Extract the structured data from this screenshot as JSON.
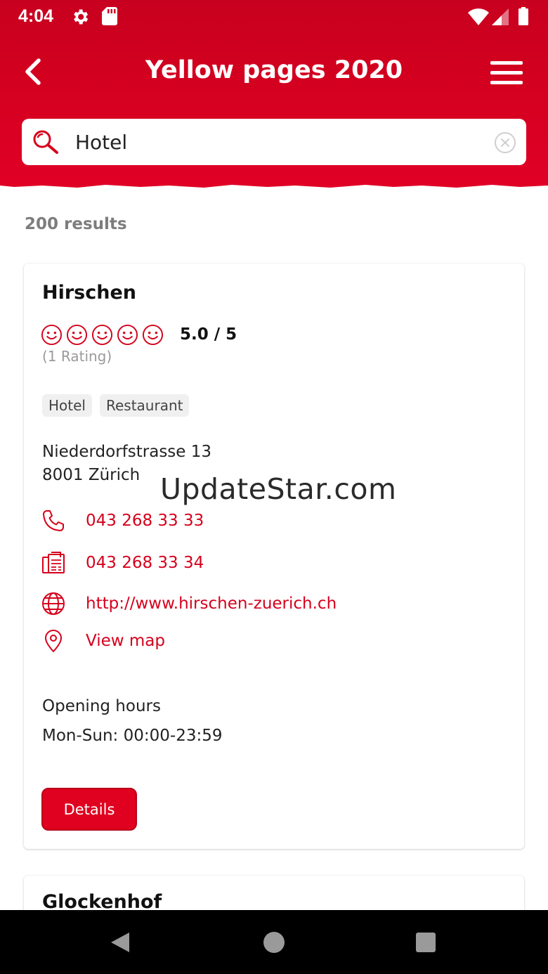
{
  "status_bar": {
    "time": "4:04"
  },
  "header": {
    "title": "Yellow pages 2020",
    "back_icon": "chevron-left-icon",
    "menu_icon": "hamburger-menu-icon"
  },
  "search": {
    "value": "Hotel",
    "placeholder": ""
  },
  "results": {
    "count_label": "200 results"
  },
  "listing": {
    "name": "Hirschen",
    "rating_value": "5.0 / 5",
    "rating_count": "(1 Rating)",
    "rating_stars": 5,
    "tags": [
      "Hotel",
      "Restaurant"
    ],
    "address_line1": "Niederdorfstrasse 13",
    "address_line2": "8001 Zürich",
    "phone": "043 268 33 33",
    "fax": "043 268 33 34",
    "website": "http://www.hirschen-zuerich.ch",
    "map_link": "View map",
    "hours_title": "Opening hours",
    "hours_value": "Mon-Sun: 00:00-23:59",
    "details_button": "Details"
  },
  "listing2": {
    "name": "Glockenhof"
  },
  "watermark": "UpdateStar.com",
  "colors": {
    "brand_red": "#d6001c",
    "header_red": "#d4001f",
    "tag_bg": "#f0f0f0"
  }
}
